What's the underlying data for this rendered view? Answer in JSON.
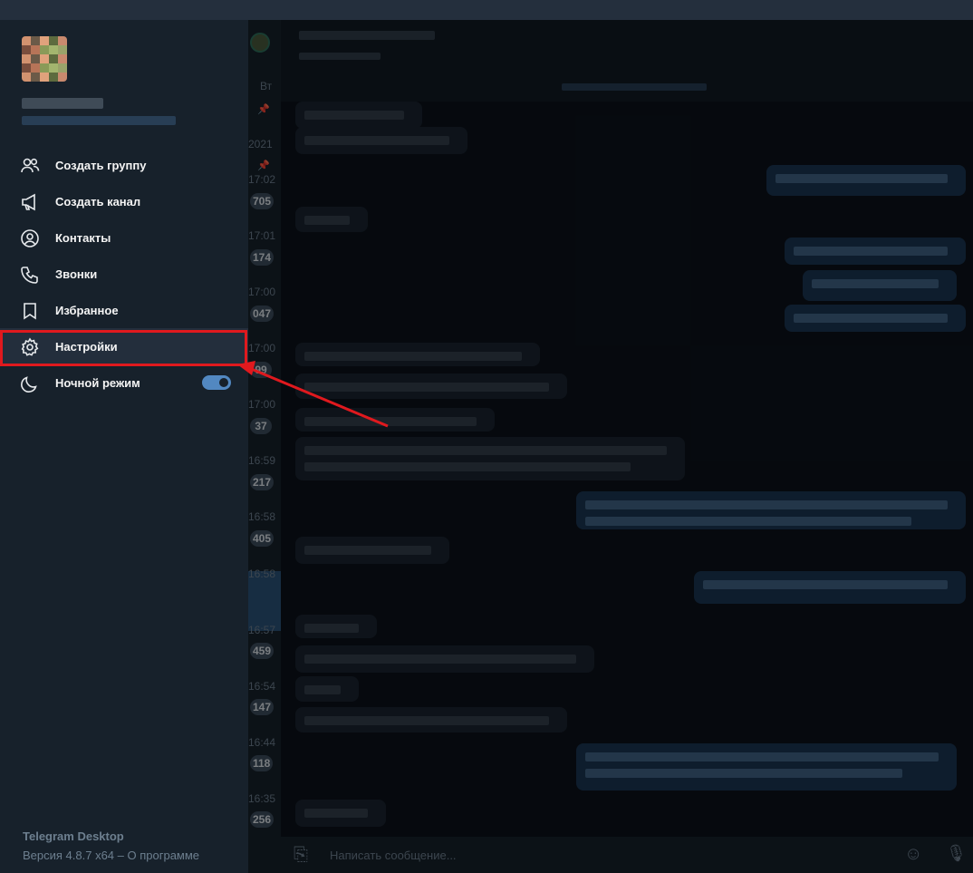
{
  "menu": {
    "items": [
      {
        "label": "Создать группу",
        "icon": "group-icon"
      },
      {
        "label": "Создать канал",
        "icon": "megaphone-icon"
      },
      {
        "label": "Контакты",
        "icon": "contact-icon"
      },
      {
        "label": "Звонки",
        "icon": "phone-icon"
      },
      {
        "label": "Избранное",
        "icon": "bookmark-icon"
      },
      {
        "label": "Настройки",
        "icon": "gear-icon"
      },
      {
        "label": "Ночной режим",
        "icon": "moon-icon"
      }
    ],
    "night_mode_on": true
  },
  "footer": {
    "app_name": "Telegram Desktop",
    "version": "Версия 4.8.7 x64",
    "separator": " – ",
    "about": "О программе"
  },
  "chatlist": {
    "header_fragment": "Вт",
    "year_fragment": "2021",
    "times": [
      "17:02",
      "17:01",
      "17:00",
      "17:00",
      "17:00",
      "16:59",
      "16:58",
      "16:58",
      "16:57",
      "16:54",
      "16:44",
      "16:35"
    ],
    "badges": [
      "705",
      "174",
      "047",
      "99",
      "37",
      "217",
      "405",
      "459",
      "147",
      "118",
      "256"
    ]
  },
  "composer": {
    "placeholder": "Написать сообщение..."
  },
  "colors": {
    "accent": "#5288c1",
    "highlight": "#e0191e"
  }
}
